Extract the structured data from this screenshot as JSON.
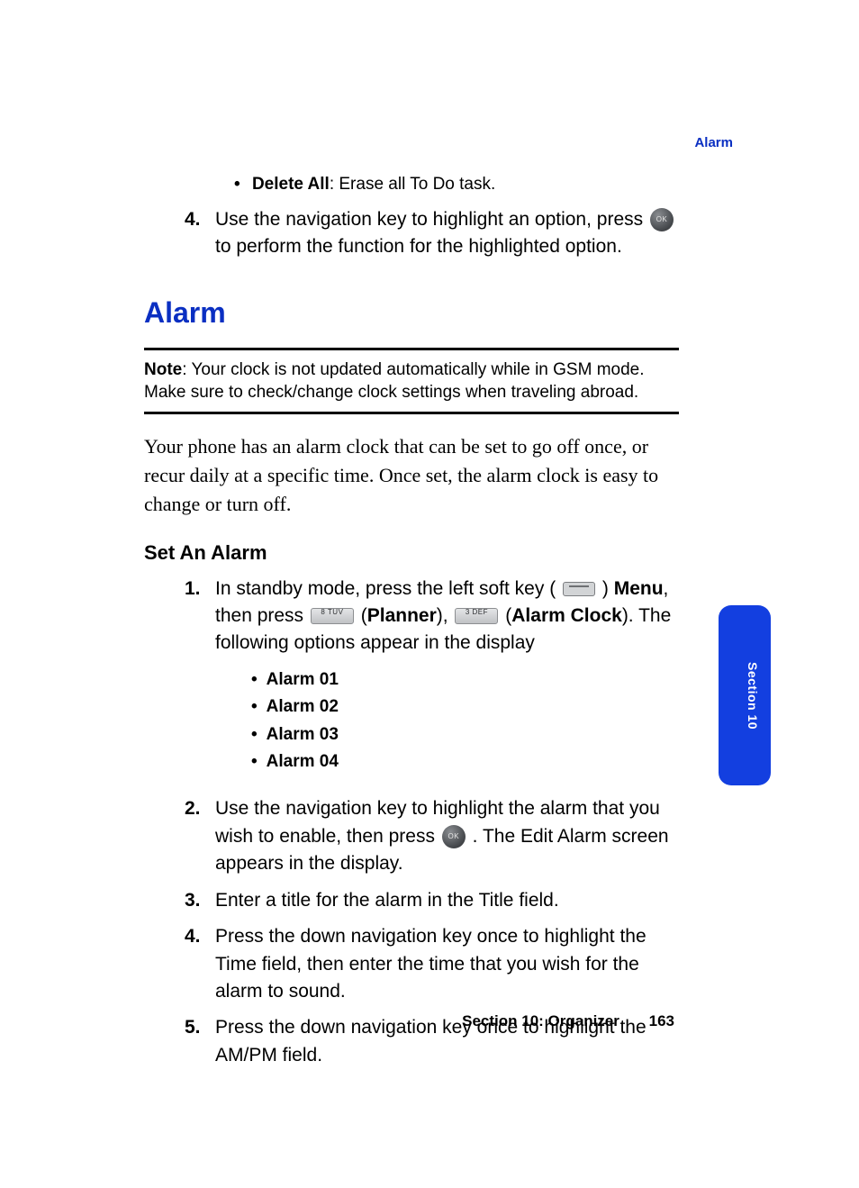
{
  "header_label": "Alarm",
  "top_bullet": {
    "bold": "Delete All",
    "rest": ": Erase all To Do task."
  },
  "top_step": {
    "num": "4.",
    "part1": "Use the navigation key to highlight an option, press ",
    "part2": " to perform the function for the highlighted option."
  },
  "heading": "Alarm",
  "note": {
    "bold": "Note",
    "text": ": Your clock is not updated automatically while in GSM mode. Make sure to check/change clock settings when traveling abroad."
  },
  "intro": "Your phone has an alarm clock that can be set to go off once, or recur daily at a specific time. Once set, the alarm clock is easy to change or turn off.",
  "subheading": "Set An Alarm",
  "steps": {
    "s1": {
      "num": "1.",
      "a": "In standby mode, press the left soft key ( ",
      "b": " ) ",
      "menu": "Menu",
      "c": ", then press ",
      "planner": "Planner",
      "d": "), ",
      "alarmclock": "Alarm Clock",
      "e": "). The following options appear in the display",
      "key8": "8 TUV",
      "key3": "3 DEF"
    },
    "alarms": [
      "Alarm 01",
      "Alarm 02",
      "Alarm 03",
      "Alarm 04"
    ],
    "s2": {
      "num": "2.",
      "a": "Use the navigation key to highlight the alarm that you wish to enable, then press ",
      "b": " . The Edit Alarm screen appears in the display."
    },
    "s3": {
      "num": "3.",
      "text": "Enter a title for the alarm in the Title field."
    },
    "s4": {
      "num": "4.",
      "text": "Press the down navigation key once to highlight the Time field, then enter the time that you wish for the alarm to sound."
    },
    "s5": {
      "num": "5.",
      "text": "Press the down navigation key once to highlight the AM/PM field."
    }
  },
  "footer": {
    "section": "Section 10: Organizer",
    "page": "163"
  },
  "side_tab": "Section 10"
}
